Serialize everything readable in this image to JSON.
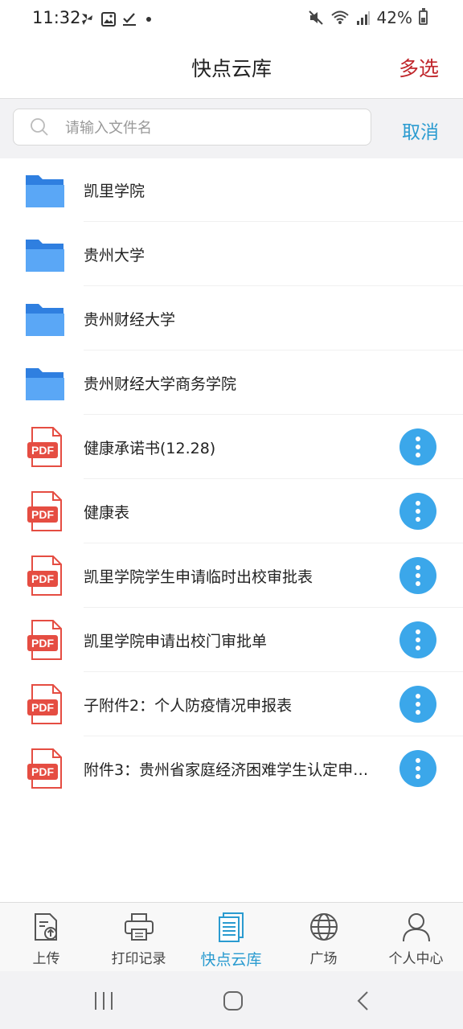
{
  "status": {
    "time": "11:32",
    "battery": "42%"
  },
  "header": {
    "title": "快点云库",
    "multi_select": "多选"
  },
  "search": {
    "placeholder": "请输入文件名",
    "cancel": "取消"
  },
  "colors": {
    "accent": "#2a9bd0",
    "multi_select": "#c0262b",
    "folder": "#3f8ff0",
    "pdf": "#e54d42",
    "more_button": "#3ba7ea"
  },
  "files": [
    {
      "type": "folder",
      "name": "凯里学院"
    },
    {
      "type": "folder",
      "name": "贵州大学"
    },
    {
      "type": "folder",
      "name": "贵州财经大学"
    },
    {
      "type": "folder",
      "name": "贵州财经大学商务学院"
    },
    {
      "type": "pdf",
      "name": "健康承诺书(12.28)",
      "icon_text": "PDF"
    },
    {
      "type": "pdf",
      "name": "健康表",
      "icon_text": "PDF"
    },
    {
      "type": "pdf",
      "name": "凯里学院学生申请临时出校审批表",
      "icon_text": "PDF"
    },
    {
      "type": "pdf",
      "name": "凯里学院申请出校门审批单",
      "icon_text": "PDF"
    },
    {
      "type": "pdf",
      "name": "子附件2：个人防疫情况申报表",
      "icon_text": "PDF"
    },
    {
      "type": "pdf",
      "name": "附件3：贵州省家庭经济困难学生认定申…",
      "icon_text": "PDF"
    }
  ],
  "nav": {
    "upload": "上传",
    "print_records": "打印记录",
    "cloud_library": "快点云库",
    "plaza": "广场",
    "profile": "个人中心"
  }
}
